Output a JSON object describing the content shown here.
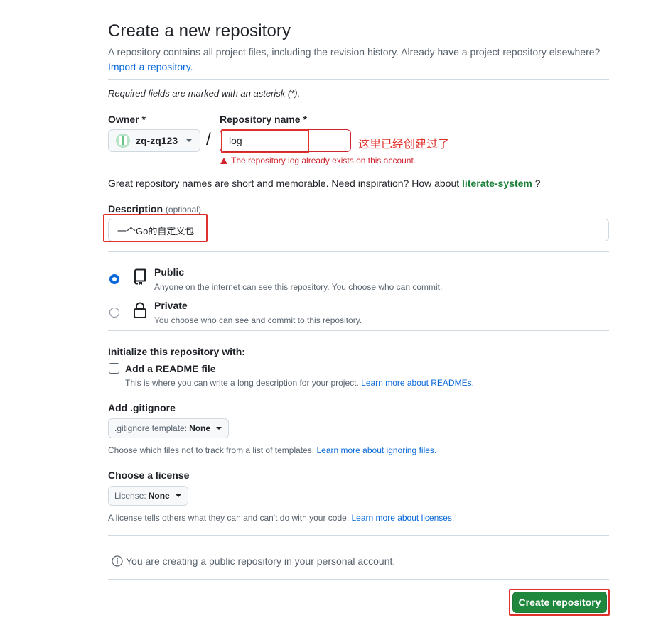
{
  "header": {
    "title": "Create a new repository",
    "subtitle": "A repository contains all project files, including the revision history. Already have a project repository elsewhere?",
    "import_link": "Import a repository."
  },
  "required_note": "Required fields are marked with an asterisk (*).",
  "owner": {
    "label": "Owner *",
    "value": "zq-zq123"
  },
  "separator": "/",
  "repo_name": {
    "label": "Repository name *",
    "value": "log",
    "error": "The repository log already exists on this account.",
    "annotation": "这里已经创建过了"
  },
  "suggestion": {
    "text": "Great repository names are short and memorable. Need inspiration? How about",
    "name": "literate-system",
    "suffix": "?"
  },
  "description": {
    "label": "Description",
    "optional": "(optional)",
    "value": "一个Go的自定义包"
  },
  "visibility": {
    "public": {
      "title": "Public",
      "desc": "Anyone on the internet can see this repository. You choose who can commit.",
      "selected": true
    },
    "private": {
      "title": "Private",
      "desc": "You choose who can see and commit to this repository.",
      "selected": false
    }
  },
  "initialize": {
    "title": "Initialize this repository with:",
    "readme_label": "Add a README file",
    "readme_desc": "This is where you can write a long description for your project.",
    "readme_link": "Learn more about READMEs.",
    "readme_checked": false
  },
  "gitignore": {
    "title": "Add .gitignore",
    "select_prefix": ".gitignore template:",
    "select_value": "None",
    "help": "Choose which files not to track from a list of templates.",
    "help_link": "Learn more about ignoring files."
  },
  "license": {
    "title": "Choose a license",
    "select_prefix": "License:",
    "select_value": "None",
    "help": "A license tells others what they can and can't do with your code.",
    "help_link": "Learn more about licenses."
  },
  "info": "You are creating a public repository in your personal account.",
  "submit_label": "Create repository",
  "colors": {
    "primary_green": "#1f883d",
    "link_blue": "#0969da",
    "error_red": "#d1242f",
    "annotation_red": "#e0302a"
  }
}
